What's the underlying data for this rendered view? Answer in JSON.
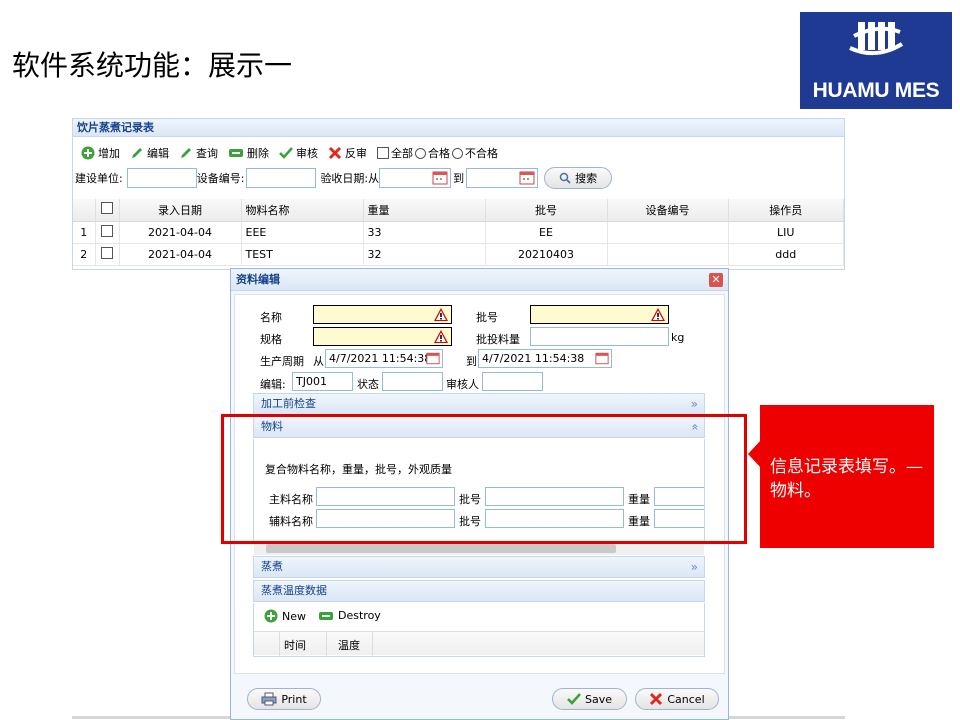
{
  "slide": {
    "title": "软件系统功能：展示一"
  },
  "logo": {
    "text": "HUAMU MES"
  },
  "panel": {
    "title": "饮片蒸煮记录表",
    "toolbar": {
      "add": "增加",
      "edit": "编辑",
      "query": "查询",
      "delete": "删除",
      "review": "审核",
      "unreview": "反审",
      "all": "全部",
      "pass": "合格",
      "fail": "不合格"
    },
    "filter": {
      "unit_label": "建设单位:",
      "device_label": "设备编号:",
      "date_label": "验收日期:从",
      "to_label": "到",
      "search": "搜索"
    },
    "columns": [
      "录入日期",
      "物料名称",
      "重量",
      "批号",
      "设备编号",
      "操作员"
    ],
    "rows": [
      {
        "no": "1",
        "date": "2021-04-04",
        "material": "EEE",
        "weight": "33",
        "batch": "EE",
        "device": "",
        "operator": "LIU"
      },
      {
        "no": "2",
        "date": "2021-04-04",
        "material": "TEST",
        "weight": "32",
        "batch": "20210403",
        "device": "",
        "operator": "ddd"
      }
    ]
  },
  "dialog": {
    "title": "资料编辑",
    "fields": {
      "name_label": "名称",
      "spec_label": "规格",
      "batch_label": "批号",
      "batch_qty_label": "批投料量",
      "kg": "kg",
      "period_label": "生产周期",
      "from": "从",
      "to": "到",
      "period_start": "4/7/2021 11:54:38",
      "period_end": "4/7/2021 11:54:38",
      "editor_label": "编辑:",
      "editor_value": "TJ001",
      "status_label": "状态",
      "reviewer_label": "审核人"
    },
    "sections": {
      "precheck": "加工前检查",
      "material": "物料",
      "material_note": "复合物料名称，重量，批号，外观质量",
      "main_material": "主料名称",
      "aux_material": "辅料名称",
      "batch": "批号",
      "weight": "重量",
      "steam": "蒸煮",
      "steam_temp": "蒸煮温度数据"
    },
    "temp_grid": {
      "new": "New",
      "destroy": "Destroy",
      "col_time": "时间",
      "col_temp": "温度"
    },
    "buttons": {
      "print": "Print",
      "save": "Save",
      "cancel": "Cancel"
    }
  },
  "callout": {
    "text": "信息记录表填写。—物料。"
  },
  "colors": {
    "accent_red": "#ee0000",
    "logo_blue": "#1f3a93",
    "header_text": "#15428b"
  }
}
